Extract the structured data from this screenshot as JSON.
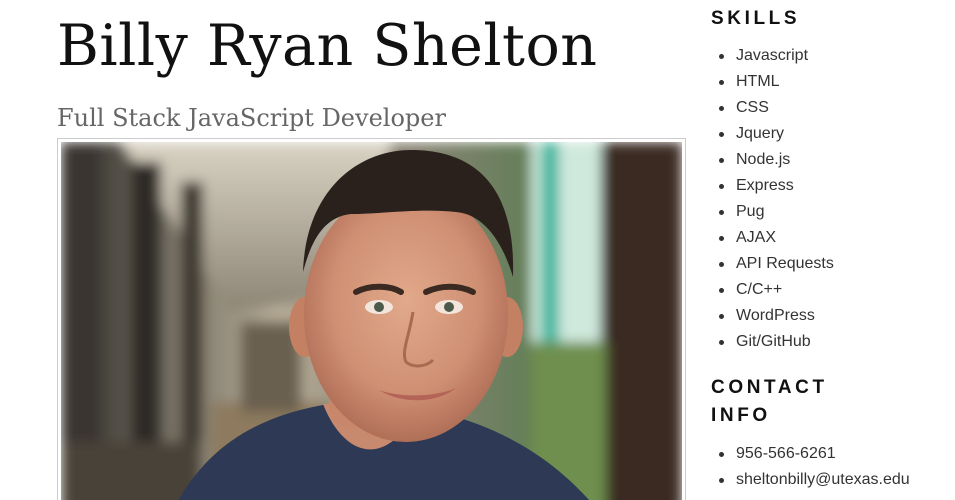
{
  "header": {
    "name": "Billy Ryan Shelton",
    "role": "Full Stack JavaScript Developer"
  },
  "photo": {
    "subject": "profile-photo"
  },
  "skills": {
    "title": "SKILLS",
    "items": [
      {
        "label": "Javascript"
      },
      {
        "label": "HTML"
      },
      {
        "label": "CSS"
      },
      {
        "label": "Jquery"
      },
      {
        "label": "Node.js"
      },
      {
        "label": "Express"
      },
      {
        "label": "Pug"
      },
      {
        "label": "AJAX"
      },
      {
        "label": "API Requests"
      },
      {
        "label": "C/C++"
      },
      {
        "label": "WordPress"
      },
      {
        "label": "Git/GitHub"
      }
    ]
  },
  "contact": {
    "title": "CONTACT INFO",
    "items": [
      {
        "label": "956-566-6261"
      },
      {
        "label": "sheltonbilly@utexas.edu"
      }
    ]
  },
  "colors": {
    "text": "#111111",
    "subtitle": "#666666",
    "list_text": "#333333",
    "frame_border": "#cccccc"
  }
}
